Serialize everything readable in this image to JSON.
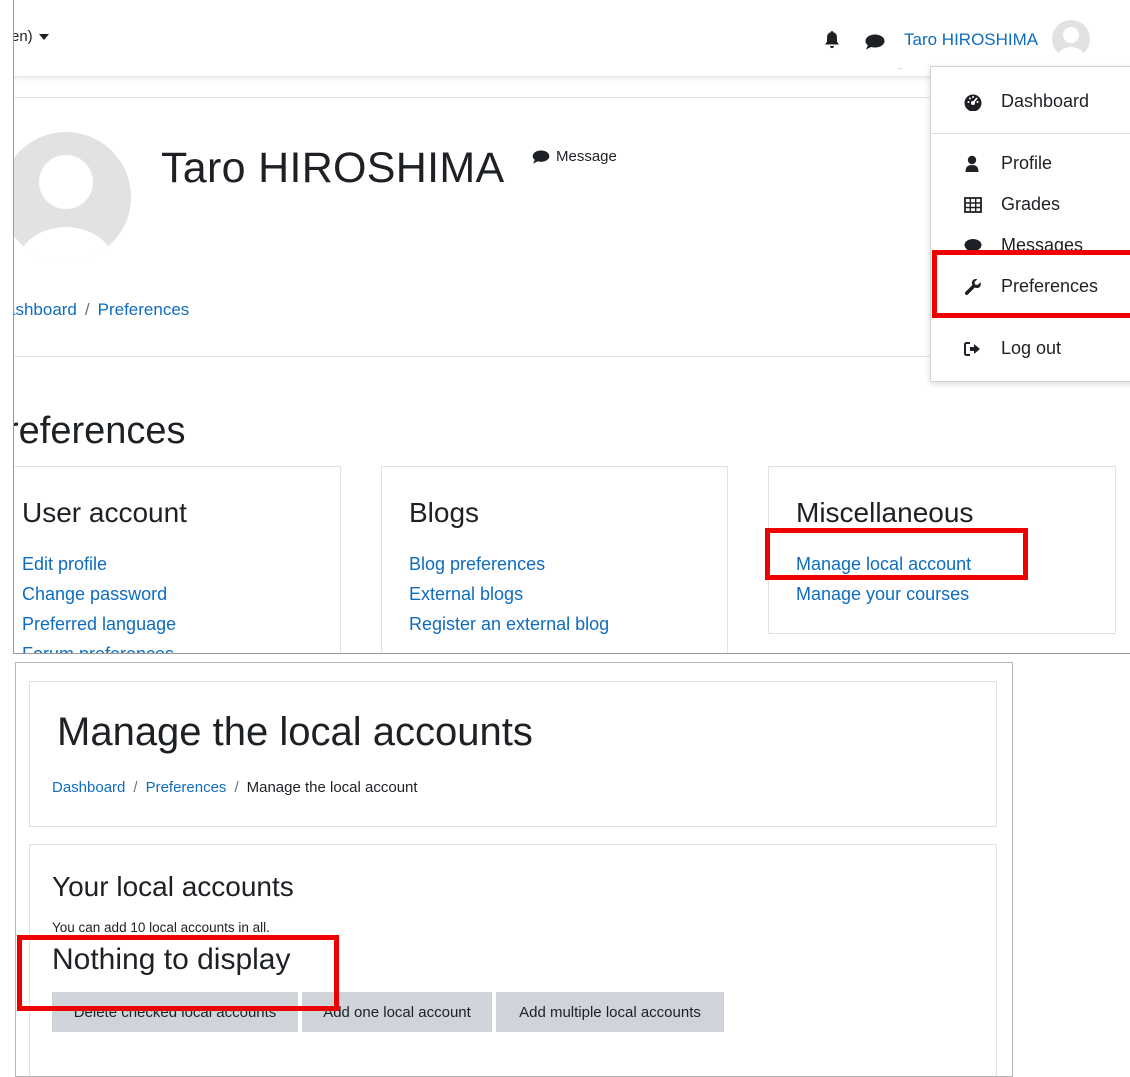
{
  "top": {
    "navbar": {
      "language_label": "en)",
      "user_name": "Taro HIROSHIMA"
    },
    "header": {
      "name": "Taro HIROSHIMA",
      "message_label": "Message",
      "breadcrumb": [
        "ashboard",
        "Preferences"
      ]
    },
    "user_menu": {
      "items": [
        {
          "label": "Dashboard",
          "icon": "dashboard-icon"
        },
        {
          "label": "Profile",
          "icon": "user-icon"
        },
        {
          "label": "Grades",
          "icon": "table-icon"
        },
        {
          "label": "Messages",
          "icon": "chat-icon"
        },
        {
          "label": "Preferences",
          "icon": "wrench-icon"
        },
        {
          "label": "Log out",
          "icon": "sign-out-icon"
        }
      ]
    },
    "preferences": {
      "title": "references",
      "cards": [
        {
          "title": "User account",
          "links": [
            "Edit profile",
            "Change password",
            "Preferred language",
            "Forum preferences"
          ]
        },
        {
          "title": "Blogs",
          "links": [
            "Blog preferences",
            "External blogs",
            "Register an external blog"
          ]
        },
        {
          "title": "Miscellaneous",
          "links": [
            "Manage local account",
            "Manage your courses"
          ]
        }
      ]
    },
    "highlight_color": "#ee0000",
    "link_color": "#0f6cbf"
  },
  "bottom": {
    "page_title": "Manage the local accounts",
    "breadcrumb": [
      "Dashboard",
      "Preferences",
      "Manage the local account"
    ],
    "section_title": "Your local accounts",
    "note": "You can add 10 local accounts in all.",
    "empty_message": "Nothing to display",
    "buttons": [
      "Delete checked local accounts",
      "Add one local account",
      "Add multiple local accounts"
    ],
    "button_bg": "#ced4da"
  }
}
